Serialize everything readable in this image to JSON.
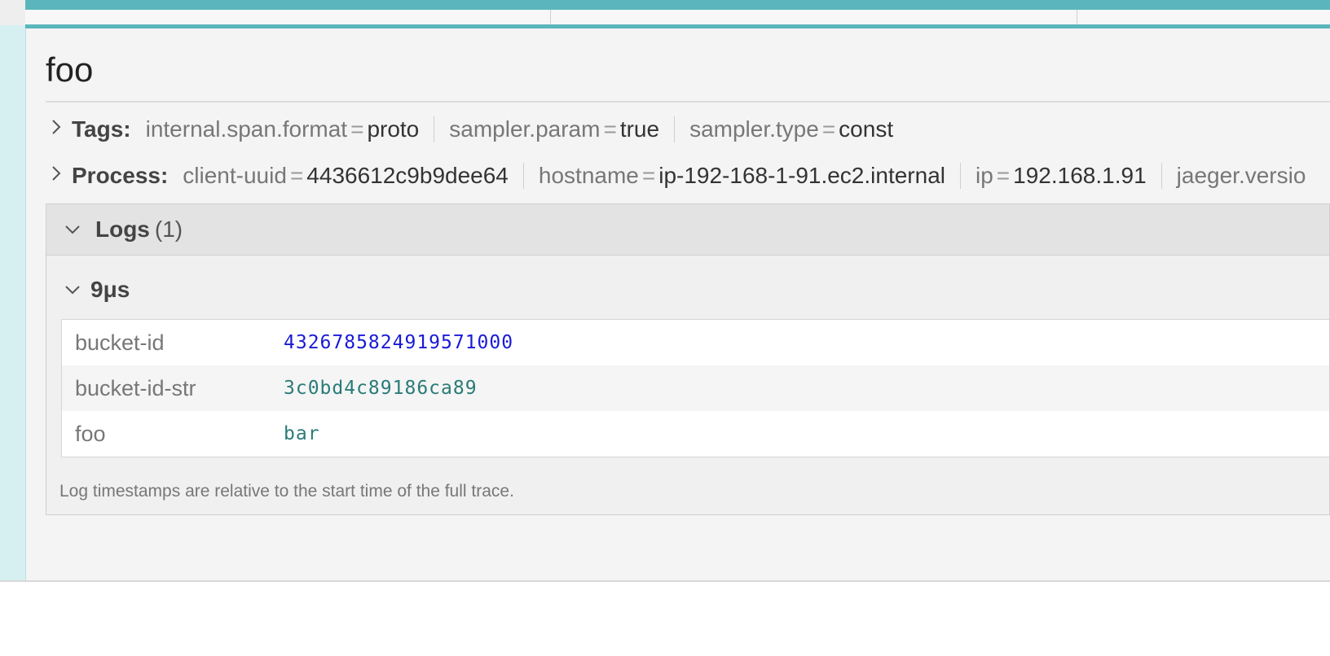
{
  "span": {
    "title": "foo",
    "tags_label": "Tags:",
    "tags": [
      {
        "key": "internal.span.format",
        "value": "proto"
      },
      {
        "key": "sampler.param",
        "value": "true"
      },
      {
        "key": "sampler.type",
        "value": "const"
      }
    ],
    "process_label": "Process:",
    "process": [
      {
        "key": "client-uuid",
        "value": "4436612c9b9dee64"
      },
      {
        "key": "hostname",
        "value": "ip-192-168-1-91.ec2.internal"
      },
      {
        "key": "ip",
        "value": "192.168.1.91"
      },
      {
        "key": "jaeger.versio",
        "value": ""
      }
    ],
    "logs": {
      "title": "Logs",
      "count": "(1)",
      "entries": [
        {
          "time": "9μs",
          "fields": [
            {
              "key": "bucket-id",
              "value": "4326785824919571000",
              "type": "number"
            },
            {
              "key": "bucket-id-str",
              "value": "3c0bd4c89186ca89",
              "type": "string"
            },
            {
              "key": "foo",
              "value": "bar",
              "type": "string"
            }
          ]
        }
      ],
      "footnote": "Log timestamps are relative to the start time of the full trace."
    }
  },
  "colors": {
    "accent": "#5ab6bc",
    "number_value": "#1a1ad6",
    "string_value": "#2a7b78"
  },
  "icons": {
    "expand": "chevron-right-icon",
    "collapse": "chevron-down-icon"
  }
}
